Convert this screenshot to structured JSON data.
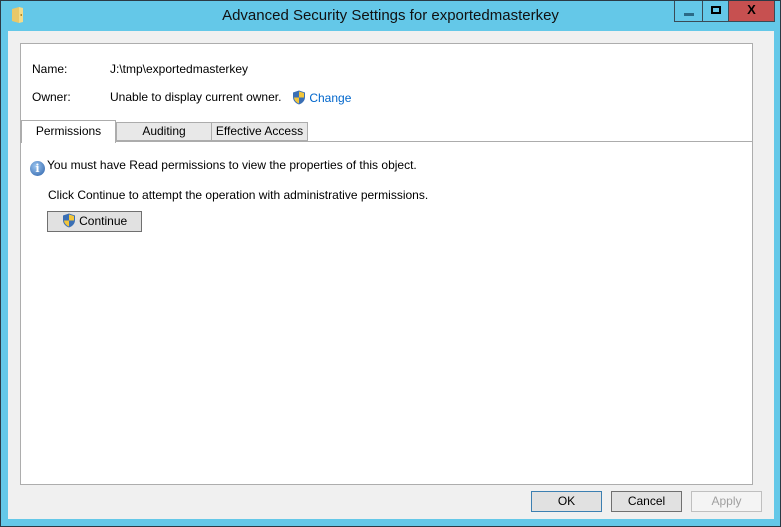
{
  "window": {
    "title": "Advanced Security Settings for exportedmasterkey",
    "app_icon": "folder-icon",
    "controls": {
      "minimize": "minimize",
      "maximize": "maximize",
      "close": "X"
    }
  },
  "details": {
    "name_label": "Name:",
    "name_value": "J:\\tmp\\exportedmasterkey",
    "owner_label": "Owner:",
    "owner_value": "Unable to display current owner.",
    "change_link": "Change",
    "change_icon": "uac-shield-icon"
  },
  "tabs": [
    {
      "label": "Permissions",
      "active": true
    },
    {
      "label": "Auditing",
      "active": false
    },
    {
      "label": "Effective Access",
      "active": false
    }
  ],
  "content": {
    "info_icon": "info-icon",
    "info_message": "You must have Read permissions to view the properties of this object.",
    "hint": "Click Continue to attempt the operation with administrative permissions.",
    "continue_label": "Continue"
  },
  "footer": {
    "ok_label": "OK",
    "cancel_label": "Cancel",
    "apply_label": "Apply",
    "apply_enabled": false
  },
  "colors": {
    "titlebar": "#64c8e8",
    "close_button": "#c75050",
    "link": "#0066cc"
  }
}
